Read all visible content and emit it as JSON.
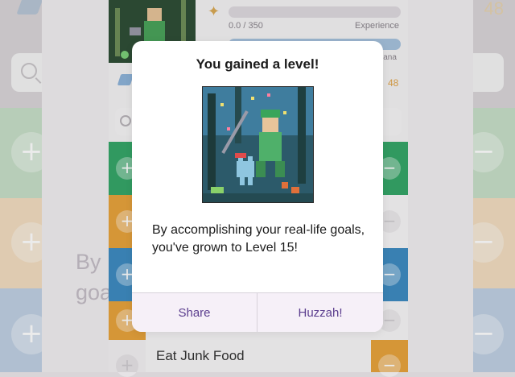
{
  "background": {
    "partial_text_line1": "By",
    "partial_text_line2": "goa",
    "gold_partial": "48"
  },
  "header": {
    "experience_value": "0.0 / 350",
    "experience_label": "Experience",
    "mana_label_partial": "lana",
    "gold": "48"
  },
  "tasks": {
    "visible_task": "Eat Junk Food"
  },
  "dialog": {
    "title": "You gained a level!",
    "message": "By accomplishing your real-life goals, you've grown to Level 15!",
    "share_label": "Share",
    "confirm_label": "Huzzah!"
  },
  "colors": {
    "green": "#c7dfc8",
    "orange": "#f2ddc1",
    "blue": "#bfd0e3",
    "dialog_button_text": "#5b3d8e",
    "mid_green": "#36a769",
    "mid_orange": "#e8a33c",
    "mid_blue": "#3e8bc2"
  }
}
